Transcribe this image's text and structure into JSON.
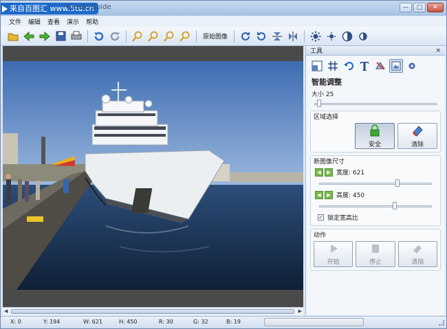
{
  "window": {
    "title": "Resize Guide",
    "watermark": "来自百图汇  www.5tu.cn",
    "minimize_icon": "minimize-icon",
    "maximize_icon": "maximize-icon",
    "close_icon": "close-icon"
  },
  "menu": [
    "文件",
    "编辑",
    "查看",
    "演示",
    "帮助"
  ],
  "toolbar": {
    "original_image_label": "原始图像",
    "icons": [
      "open-folder-icon",
      "back-arrow-icon",
      "forward-arrow-icon",
      "save-icon",
      "print-icon",
      "undo-icon",
      "redo-icon",
      "zoom-in-icon",
      "zoom-out-icon",
      "zoom-fit-icon",
      "zoom-actual-icon",
      "rotate-right-icon",
      "rotate-left-icon",
      "flip-vertical-icon",
      "flip-horizontal-icon",
      "brightness-up-icon",
      "brightness-down-icon",
      "contrast-up-icon",
      "contrast-down-icon"
    ]
  },
  "panel": {
    "header_title": "工具",
    "close_label": "×",
    "tool_icons": [
      "resize-icon",
      "crop-grid-icon",
      "undo-tool-icon",
      "text-tool-icon",
      "smart-resize-tool-icon",
      "smart-resize-active-icon",
      "settings-tool-icon"
    ],
    "title": "智能调整",
    "size_label": "大小 25",
    "size_value": 25,
    "region_section": "区域选择",
    "safe_label": "安全",
    "clear_label": "清除",
    "new_size_section": "新图像尺寸",
    "width_label": "宽度: 621",
    "width_fraction": 0.7,
    "height_label": "高度: 450",
    "height_fraction": 0.68,
    "lock_ratio_label": "锁定宽高比",
    "lock_ratio_checked": true,
    "action_section": "动作",
    "start_label": "开始",
    "stop_label": "停止",
    "action_clear_label": "清除"
  },
  "status": {
    "x": "X: 0",
    "y": "Y: 194",
    "w": "W: 621",
    "h": "H: 450",
    "r": "R: 30",
    "g": "G: 32",
    "b": "B: 19"
  },
  "colors": {
    "accent": "#1d6ac9",
    "sky": "#4d77b8",
    "water": "#1d3452",
    "hull": "#e9ecef"
  }
}
